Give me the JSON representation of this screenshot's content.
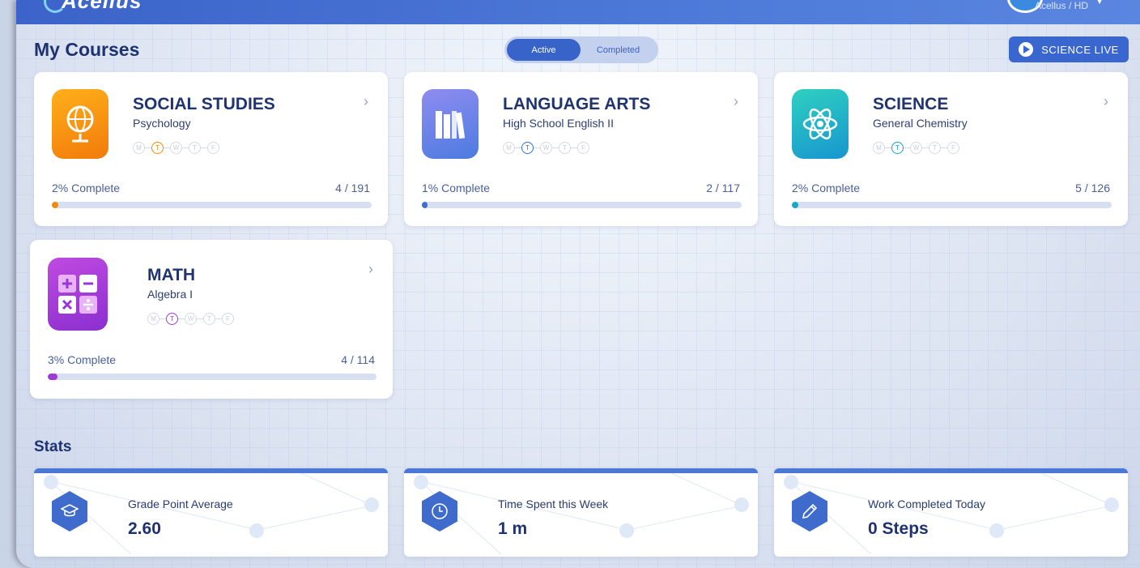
{
  "header": {
    "logo_text": "Acellus",
    "profile_label": "Acellus / HD"
  },
  "page_title": "My Courses",
  "toggle": {
    "active": "Active",
    "completed": "Completed"
  },
  "science_live": "SCIENCE LIVE",
  "days": [
    "M",
    "T",
    "W",
    "T",
    "F"
  ],
  "courses": [
    {
      "title": "SOCIAL STUDIES",
      "subtitle": "Psychology",
      "percent": "2% Complete",
      "progress": 0.02,
      "count": "4 / 191",
      "accent": "#f28a0a",
      "icon": "globe-icon"
    },
    {
      "title": "LANGUAGE ARTS",
      "subtitle": "High School English II",
      "percent": "1% Complete",
      "progress": 0.01,
      "count": "2 / 117",
      "accent": "#3c6fd1",
      "icon": "books-icon"
    },
    {
      "title": "SCIENCE",
      "subtitle": "General Chemistry",
      "percent": "2% Complete",
      "progress": 0.02,
      "count": "5 / 126",
      "accent": "#17a8c8",
      "icon": "atom-icon"
    },
    {
      "title": "MATH",
      "subtitle": "Algebra I",
      "percent": "3% Complete",
      "progress": 0.03,
      "count": "4 / 114",
      "accent": "#9d3ad8",
      "icon": "math-operators-icon"
    }
  ],
  "stats_title": "Stats",
  "stats": [
    {
      "label": "Grade Point Average",
      "value": "2.60",
      "icon": "graduation-cap-icon"
    },
    {
      "label": "Time Spent this Week",
      "value": "1 m",
      "icon": "clock-icon"
    },
    {
      "label": "Work Completed Today",
      "value": "0 Steps",
      "icon": "pencil-icon"
    }
  ]
}
